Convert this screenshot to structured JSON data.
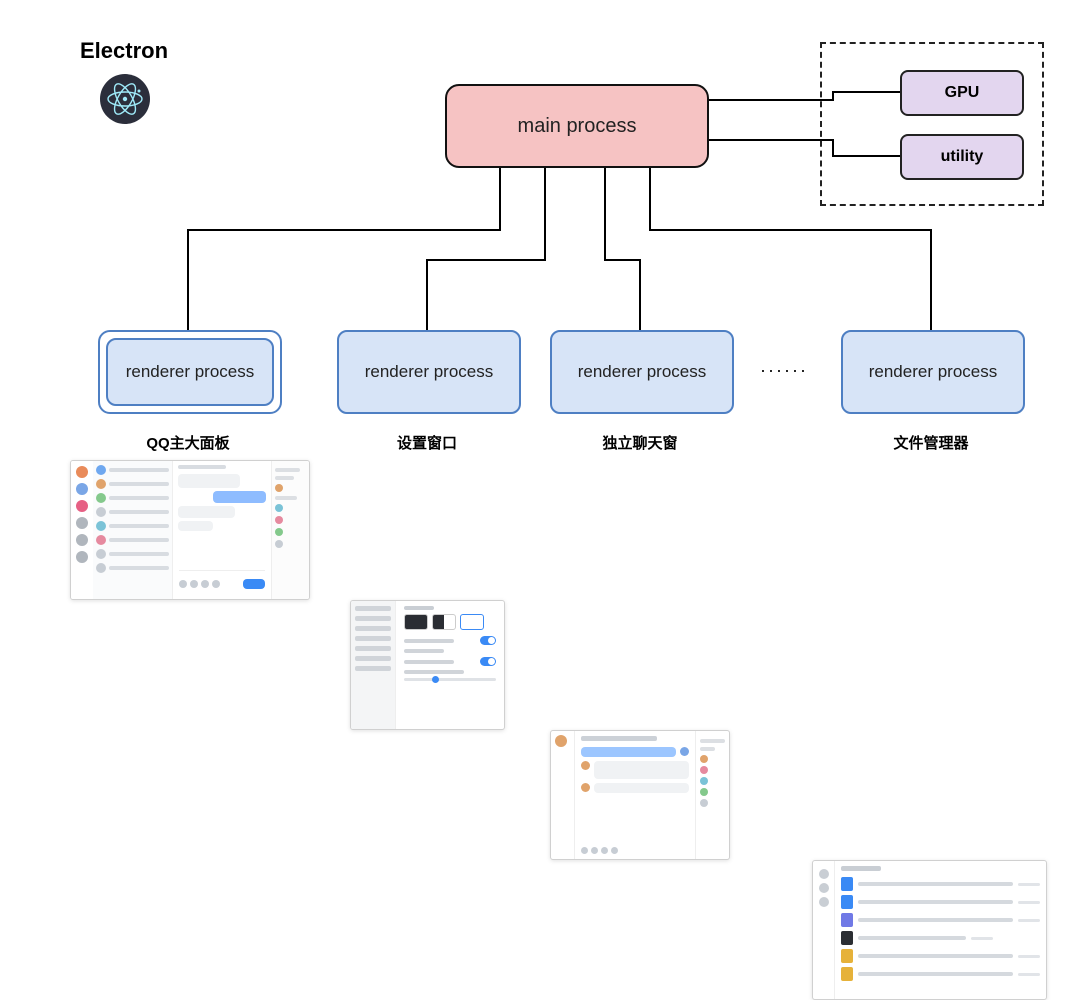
{
  "header": {
    "title": "Electron"
  },
  "main": {
    "label": "main process"
  },
  "modules": {
    "gpu": "GPU",
    "utility": "utility"
  },
  "renderers": {
    "r1": "renderer process",
    "r2": "renderer process",
    "r3": "renderer process",
    "r4": "renderer process",
    "ellipsis": "······"
  },
  "captions": {
    "c1": "QQ主大面板",
    "c2": "设置窗口",
    "c3": "独立聊天窗",
    "c4": "文件管理器"
  }
}
